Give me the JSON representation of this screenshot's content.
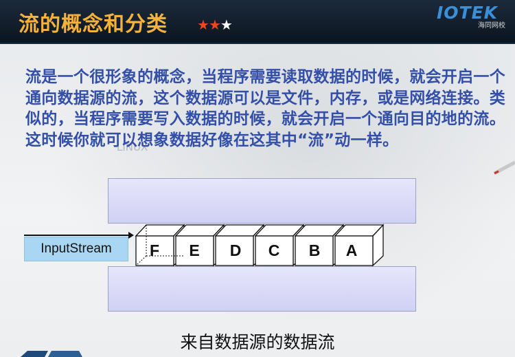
{
  "header": {
    "title": "流的概念和分类",
    "stars": [
      "★",
      "★",
      "★"
    ],
    "stars_filled": 2,
    "logo_main": "IOTEK",
    "logo_sub": "海同网校"
  },
  "watermark": "LINUX",
  "paragraph": "流是一个很形象的概念，当程序需要读取数据的时候，就会开启一个通向数据源的流，这个数据源可以是文件，内存，或是网络连接。类似的，当程序需要写入数据的时候，就会开启一个通向目的地的流。这时候你就可以想象数据好像在这其中“流”动一样。",
  "diagram": {
    "stream_label": "InputStream",
    "blocks": [
      "F",
      "E",
      "D",
      "C",
      "B",
      "A"
    ],
    "caption": "来自数据源的数据流"
  },
  "colors": {
    "title": "#f4b23a",
    "text": "#334fa8",
    "star_on": "#e8491d",
    "band": "#dcdcf7",
    "label_bg": "#a9d6f2"
  }
}
